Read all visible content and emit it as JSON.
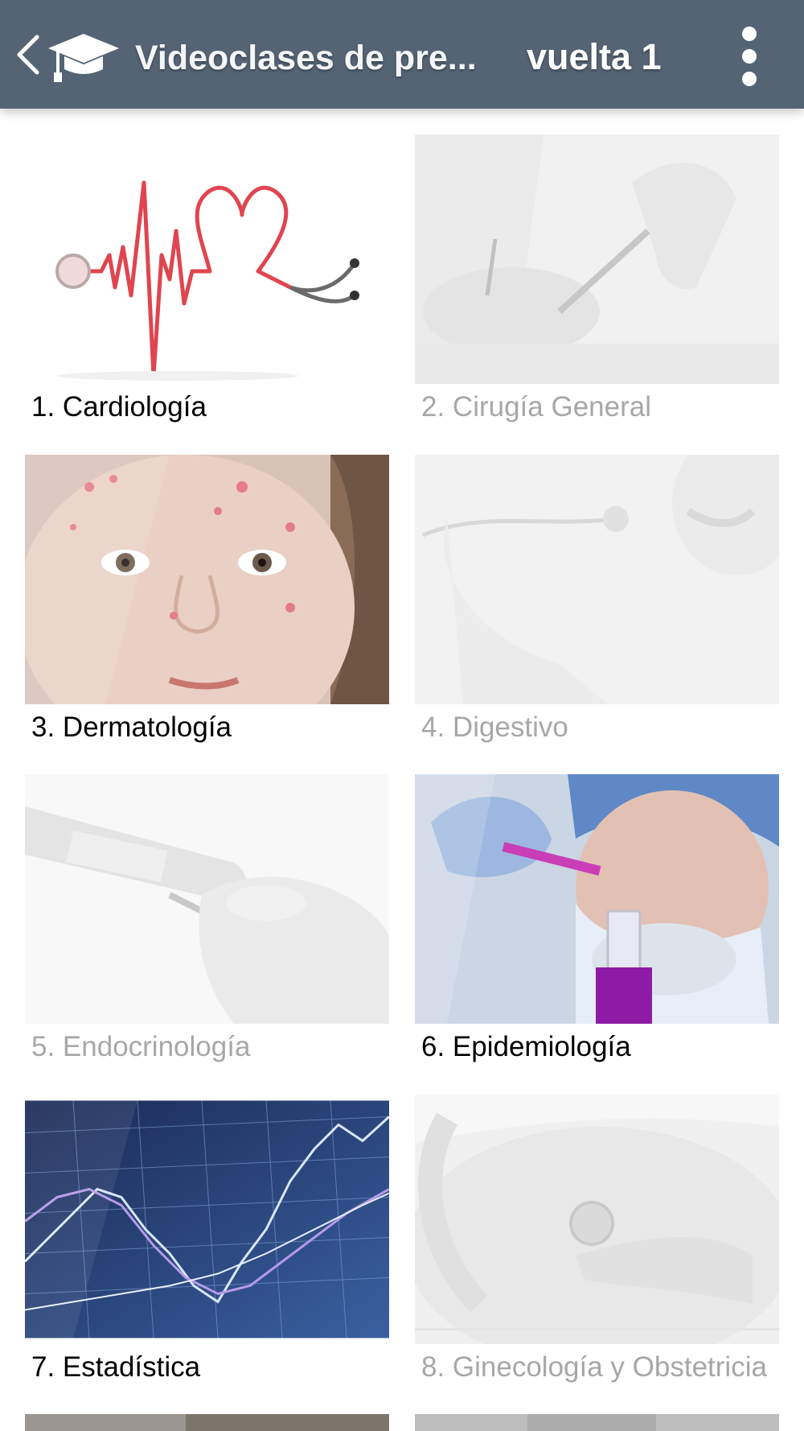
{
  "appbar": {
    "title": "Videoclases de pre...",
    "subtitle": "vuelta 1"
  },
  "colors": {
    "appbar_bg": "#556475",
    "label_enabled": "#1f5771",
    "label_disabled": "#a7a7a7"
  },
  "icons": [
    "back-arrow-icon",
    "graduation-cap-icon",
    "more-vert-icon"
  ],
  "tiles": [
    {
      "label": "1. Cardiología",
      "enabled": true
    },
    {
      "label": "2. Cirugía General",
      "enabled": false
    },
    {
      "label": "3. Dermatología",
      "enabled": true
    },
    {
      "label": "4. Digestivo",
      "enabled": false
    },
    {
      "label": "5. Endocrinología",
      "enabled": false
    },
    {
      "label": "6. Epidemiología",
      "enabled": true
    },
    {
      "label": "7. Estadística",
      "enabled": true
    },
    {
      "label": "8. Ginecología y Obstetricia",
      "enabled": false
    }
  ]
}
